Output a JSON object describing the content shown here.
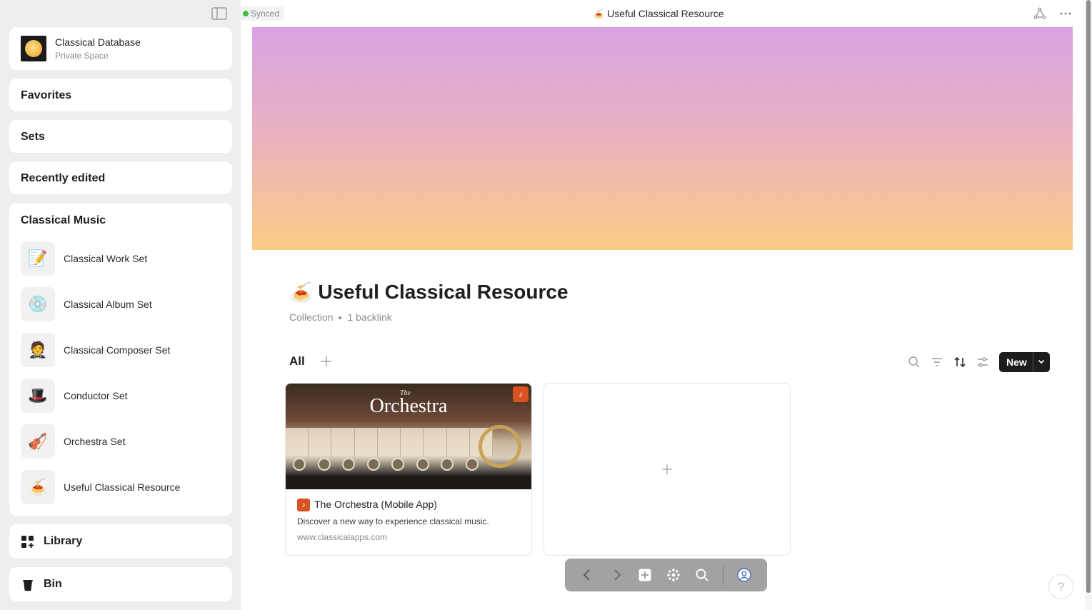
{
  "sidebar": {
    "space": {
      "name": "Classical Database",
      "subtitle": "Private Space"
    },
    "sections": {
      "favorites": "Favorites",
      "sets": "Sets",
      "recently_edited": "Recently edited"
    },
    "group": {
      "title": "Classical Music",
      "items": [
        {
          "label": "Classical Work Set",
          "icon": "📝"
        },
        {
          "label": "Classical Album Set",
          "icon": "💿"
        },
        {
          "label": "Classical Composer Set",
          "icon": "🤵"
        },
        {
          "label": "Conductor Set",
          "icon": "🎩"
        },
        {
          "label": "Orchestra Set",
          "icon": "🎻"
        },
        {
          "label": "Useful Classical Resource",
          "icon": "🍝"
        }
      ]
    },
    "library": "Library",
    "bin": "Bin"
  },
  "topbar": {
    "sync_status": "Synced",
    "title_emoji": "🍝",
    "title": "Useful Classical Resource"
  },
  "page": {
    "emoji": "🍝",
    "title": "Useful Classical Resource",
    "type": "Collection",
    "backlinks": "1 backlink",
    "view_tab": "All",
    "new_button": "New"
  },
  "cards": [
    {
      "title": "The Orchestra (Mobile App)",
      "description": "Discover a new way to experience classical music.",
      "url": "www.classicalapps.com",
      "cover_the": "The",
      "cover_title": "Orchestra"
    }
  ],
  "help": "?",
  "colors": {
    "cover_top": "#d8a2e2",
    "cover_bottom": "#fccb85",
    "sidebar_bg": "#eeeeee",
    "synced_dot": "#3dbf3d",
    "new_button_bg": "#1d1d1d"
  }
}
